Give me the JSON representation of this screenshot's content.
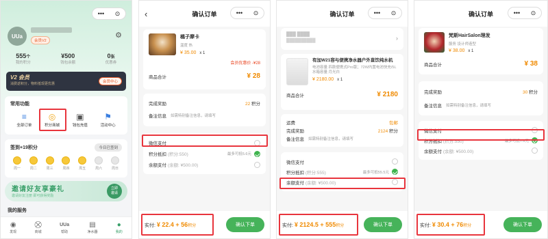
{
  "capsule": {
    "more": "•••",
    "close": "⊙"
  },
  "p1": {
    "logo": "UUa",
    "tag": "会员V2",
    "stats": [
      {
        "value": "555",
        "unit": "个",
        "label": "我的积分"
      },
      {
        "value": "¥500",
        "unit": "",
        "label": "钱包余额"
      },
      {
        "value": "0",
        "unit": "张",
        "label": "优惠券"
      }
    ],
    "vip": {
      "title": "V2 会员",
      "desc": "消费返积分，物料抵现更优惠",
      "btn": "会员中心"
    },
    "funcs_title": "常用功能",
    "funcs": [
      {
        "label": "全部订单",
        "icon": "≡"
      },
      {
        "label": "积分商城",
        "icon": "◎"
      },
      {
        "label": "钱包充值",
        "icon": "▣"
      },
      {
        "label": "活动中心",
        "icon": "⚑"
      }
    ],
    "checkin": {
      "title": "签到+19积分",
      "btn": "今日已签到",
      "days": [
        "周一",
        "周二",
        "周三",
        "周四",
        "周五",
        "周六",
        "周日"
      ]
    },
    "banner": {
      "title": "邀请好友享豪礼",
      "sub": "邀请好友注册 即可获得奖励",
      "btn1": "立即",
      "btn2": "邀请"
    },
    "profile_label": "我的服务",
    "tabs": [
      {
        "label": "发现",
        "icon": "◉"
      },
      {
        "label": "商城",
        "icon": "⛒"
      },
      {
        "label": "帮助",
        "icon": "UUa"
      },
      {
        "label": "净水器",
        "icon": "▤"
      },
      {
        "label": "我的",
        "icon": "●"
      }
    ]
  },
  "p2": {
    "title": "确认订单",
    "product": {
      "name": "橘子摩卡",
      "spec": "温度 热",
      "price": "¥ 35.00",
      "qty": "x 1",
      "coupon": "会员优惠价 -¥28"
    },
    "subtotal_label": "商品合计",
    "subtotal": "¥ 28",
    "reward_label": "完成奖励",
    "reward": "22",
    "reward_unit": "积分",
    "note_label": "备注信息",
    "note_ph": "如需特别备注信息，请填写",
    "pay": [
      {
        "label": "微信支付",
        "sub": "",
        "right": ""
      },
      {
        "label": "积分抵扣",
        "sub": "(积分:550)",
        "right": "最多可抵5.6元"
      },
      {
        "label": "余额支付",
        "sub": "(余额: ¥500.00)",
        "right": ""
      }
    ],
    "total_prefix": "实付: ",
    "total": "¥ 22.4 + 56",
    "total_unit": "积分",
    "submit": "确认下单"
  },
  "p3": {
    "title": "确认订单",
    "address": "███ ████",
    "address_sub": "██████████",
    "product": {
      "name": "有加W21容与便携净水器户外直饮纯水机",
      "spec": "电池容量 四款便携式Pro版；72W内置电池快充/5L",
      "spec2": "水箱容量 月光白",
      "price": "¥ 2180.00",
      "qty": "x 1"
    },
    "subtotal_label": "商品合计",
    "subtotal": "¥ 2180",
    "ship_label": "运费",
    "ship": "包邮",
    "reward_label": "完成奖励",
    "reward": "2124",
    "reward_unit": "积分",
    "note_label": "备注信息",
    "note_ph": "如需特别备注信息，请填写",
    "pay": [
      {
        "label": "微信支付",
        "sub": "",
        "right": ""
      },
      {
        "label": "积分抵扣",
        "sub": "(积分:555)",
        "right": "最多可抵55.5元"
      },
      {
        "label": "余额支付",
        "sub": "(余额: ¥500.00)",
        "right": ""
      }
    ],
    "total_prefix": "实付: ",
    "total": "¥ 2124.5 + 555",
    "total_unit": "积分",
    "submit": "确认下单"
  },
  "p4": {
    "title": "确认订单",
    "product": {
      "name": "梵斯HairSalon理发",
      "spec": "服务 设计师造型",
      "price": "¥ 38.00",
      "qty": "x 1"
    },
    "subtotal_label": "商品合计",
    "subtotal": "¥ 38",
    "reward_label": "完成奖励",
    "reward": "30",
    "reward_unit": "积分",
    "note_label": "备注信息",
    "note_ph": "如需特别备注信息，请填写",
    "pay": [
      {
        "label": "微信支付",
        "sub": "",
        "right": ""
      },
      {
        "label": "积分抵扣",
        "sub": "(积分:550)",
        "right": "最多可抵7.6元"
      },
      {
        "label": "余额支付",
        "sub": "(余额: ¥500.00)",
        "right": ""
      }
    ],
    "total_prefix": "实付: ",
    "total": "¥ 30.4 + 76",
    "total_unit": "积分",
    "submit": "确认下单"
  }
}
